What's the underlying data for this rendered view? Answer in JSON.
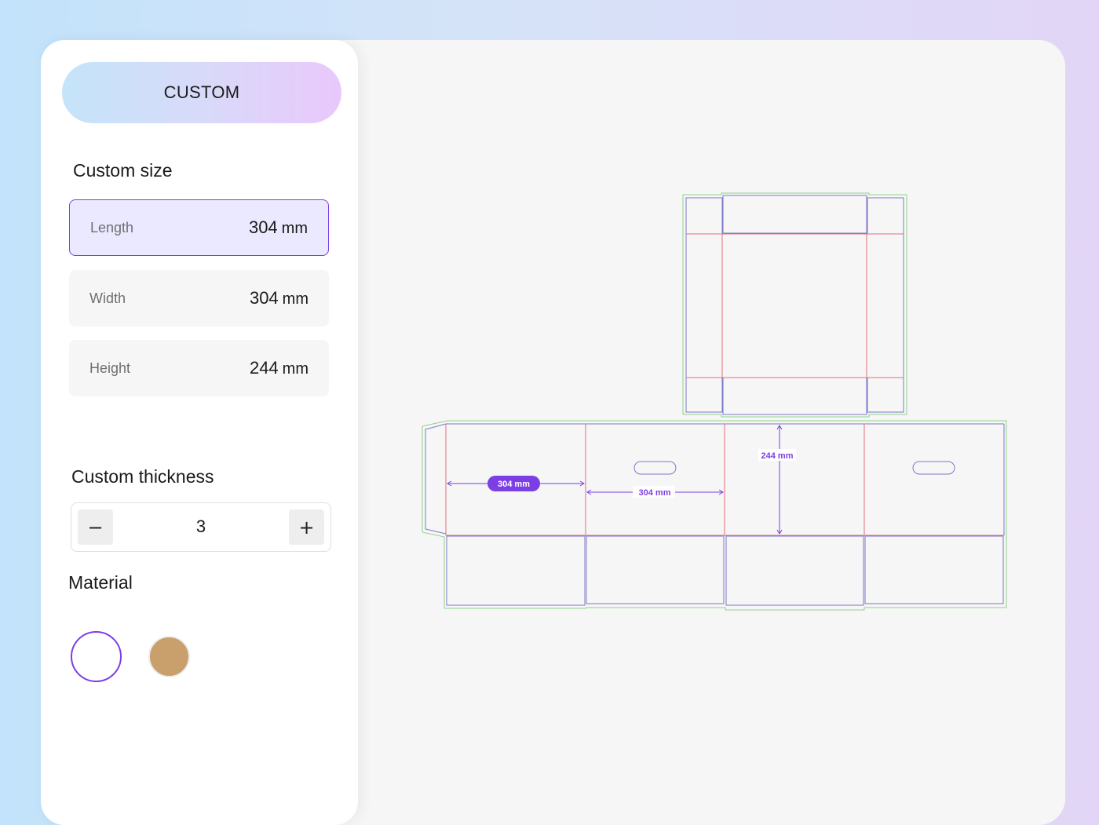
{
  "panel": {
    "mode_label": "CUSTOM",
    "size_title": "Custom size",
    "fields": [
      {
        "label": "Length",
        "value": "304",
        "unit": "mm"
      },
      {
        "label": "Width",
        "value": "304",
        "unit": "mm"
      },
      {
        "label": "Height",
        "value": "244",
        "unit": "mm"
      }
    ],
    "thickness_title": "Custom thickness",
    "thickness": {
      "value": "3",
      "minus_label": "−",
      "plus_label": "+"
    },
    "material_title": "Material",
    "materials": [
      {
        "name": "white",
        "color": "#ffffff",
        "selected": true
      },
      {
        "name": "kraft",
        "color": "#c9a06b",
        "selected": false
      }
    ]
  },
  "dieline": {
    "length_label": "304 mm",
    "width_label": "304 mm",
    "height_label": "244 mm",
    "colors": {
      "cut": "#7d78c8",
      "fold": "#e26e7e",
      "bleed": "#8ed38a",
      "dimension": "#7b3fe4"
    }
  }
}
